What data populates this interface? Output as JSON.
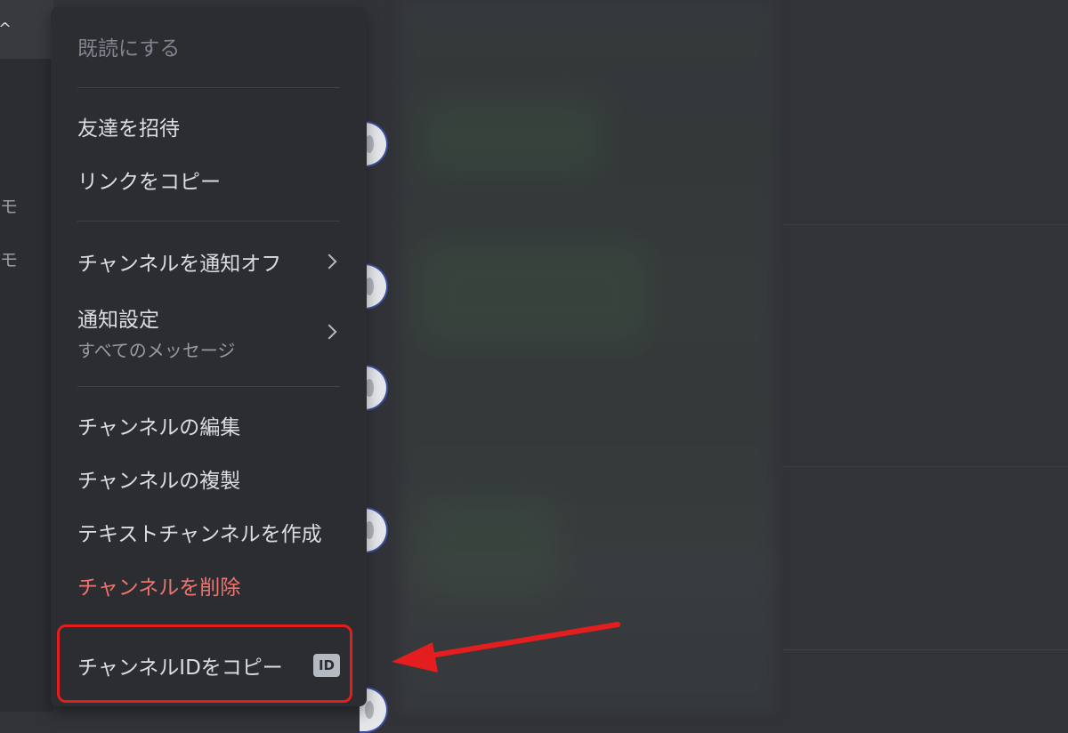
{
  "sidebar": {
    "caret": "^",
    "fragments": [
      "モ",
      "モ"
    ]
  },
  "menu": {
    "mark_read": "既読にする",
    "invite_friends": "友達を招待",
    "copy_link": "リンクをコピー",
    "mute_channel": "チャンネルを通知オフ",
    "notification_settings": "通知設定",
    "notification_value": "すべてのメッセージ",
    "edit_channel": "チャンネルの編集",
    "duplicate_channel": "チャンネルの複製",
    "create_text_channel": "テキストチャンネルを作成",
    "delete_channel": "チャンネルを削除",
    "copy_channel_id": "チャンネルIDをコピー",
    "id_badge": "ID"
  },
  "colors": {
    "menu_bg": "#2b2d31",
    "danger": "#f0736f",
    "annotation": "#e41e1e"
  },
  "icons": [
    "chevron-right-icon",
    "id-badge-icon",
    "arrow-annotation"
  ]
}
